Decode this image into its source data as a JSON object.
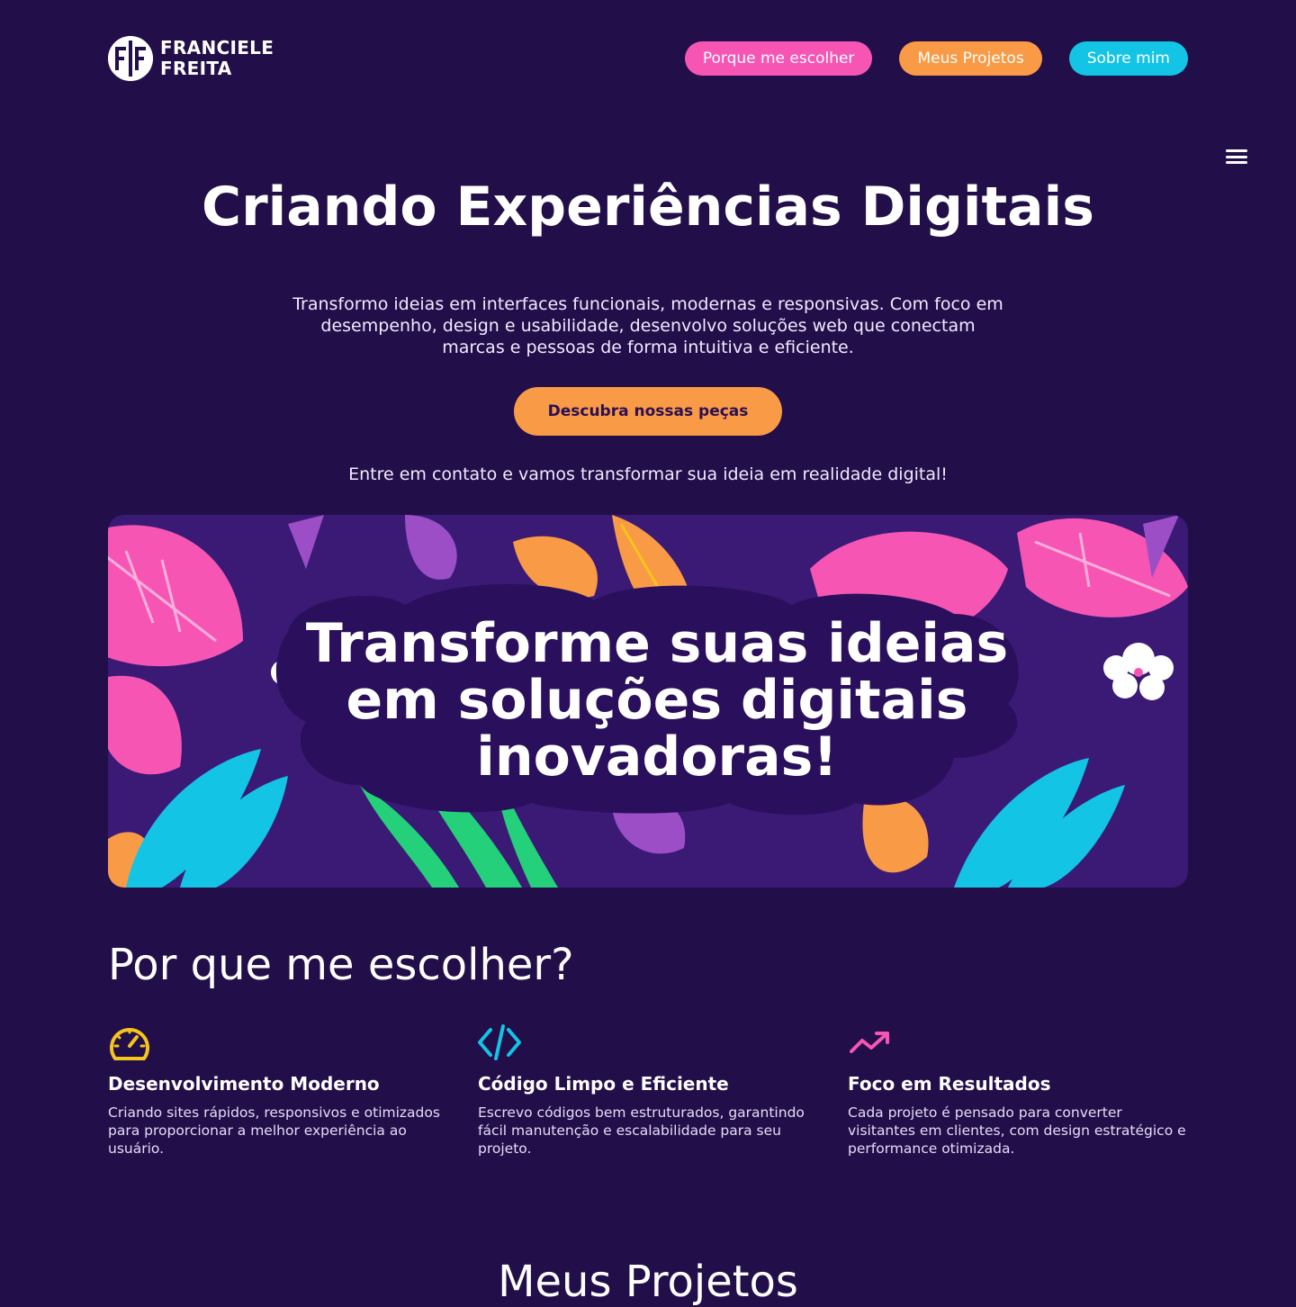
{
  "header": {
    "logo_line1": "FRANCIELE",
    "logo_line2": "FREITA",
    "nav": [
      {
        "label": "Porque me escolher",
        "color": "#f655b4"
      },
      {
        "label": "Meus Projetos",
        "color": "#f99a46"
      },
      {
        "label": "Sobre mim",
        "color": "#13c4e5"
      }
    ]
  },
  "hero": {
    "title": "Criando Experiências Digitais",
    "subtitle": "Transformo ideias em interfaces funcionais, modernas e responsivas. Com foco em desempenho, design e usabilidade, desenvolvo soluções web que conectam marcas e pessoas de forma intuitiva e eficiente.",
    "cta_label": "Descubra nossas peças",
    "contact_text": "Entre em contato e vamos transformar sua ideia em realidade digital!"
  },
  "banner": {
    "text": "Transforme suas ideias em soluções digitais inovadoras!"
  },
  "why": {
    "title": "Por que me escolher?",
    "features": [
      {
        "icon": "speedometer-icon",
        "title": "Desenvolvimento Moderno",
        "text": "Criando sites rápidos, responsivos e otimizados para proporcionar a melhor experiência ao usuário.",
        "color": "#f5c51b"
      },
      {
        "icon": "code-icon",
        "title": "Código Limpo e Eficiente",
        "text": "Escrevo códigos bem estruturados, garantindo fácil manutenção e escalabilidade para seu projeto.",
        "color": "#13c4e5"
      },
      {
        "icon": "trending-up-icon",
        "title": "Foco em Resultados",
        "text": "Cada projeto é pensado para converter visitantes em clientes, com design estratégico e performance otimizada.",
        "color": "#f655b4"
      }
    ]
  },
  "projects": {
    "title": "Meus Projetos"
  },
  "colors": {
    "background": "#220e49",
    "accent_orange": "#f99a46",
    "accent_pink": "#f655b4",
    "accent_cyan": "#13c4e5"
  }
}
